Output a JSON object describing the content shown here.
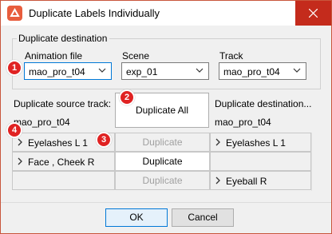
{
  "window": {
    "title": "Duplicate Labels Individually"
  },
  "destination_group": {
    "legend": "Duplicate destination",
    "animation_file": {
      "label": "Animation file",
      "value": "mao_pro_t04"
    },
    "scene": {
      "label": "Scene",
      "value": "exp_01"
    },
    "track": {
      "label": "Track",
      "value": "mao_pro_t04"
    }
  },
  "source": {
    "label": "Duplicate source track:",
    "value": "mao_pro_t04"
  },
  "destination": {
    "label": "Duplicate destination...",
    "value": "mao_pro_t04"
  },
  "duplicate_all_label": "Duplicate All",
  "rows": [
    {
      "source": "Eyelashes L 1",
      "action": "Duplicate",
      "enabled": false,
      "destination": "Eyelashes L 1"
    },
    {
      "source": "Face , Cheek R",
      "action": "Duplicate",
      "enabled": true,
      "destination": ""
    },
    {
      "source": "",
      "action": "Duplicate",
      "enabled": false,
      "destination": "Eyeball R"
    }
  ],
  "buttons": {
    "ok": "OK",
    "cancel": "Cancel"
  },
  "badges": [
    "1",
    "2",
    "3",
    "4"
  ],
  "colors": {
    "accent": "#0078d7",
    "close": "#c42b1c",
    "badge": "#e02222",
    "app_icon": "#e85d3d"
  }
}
